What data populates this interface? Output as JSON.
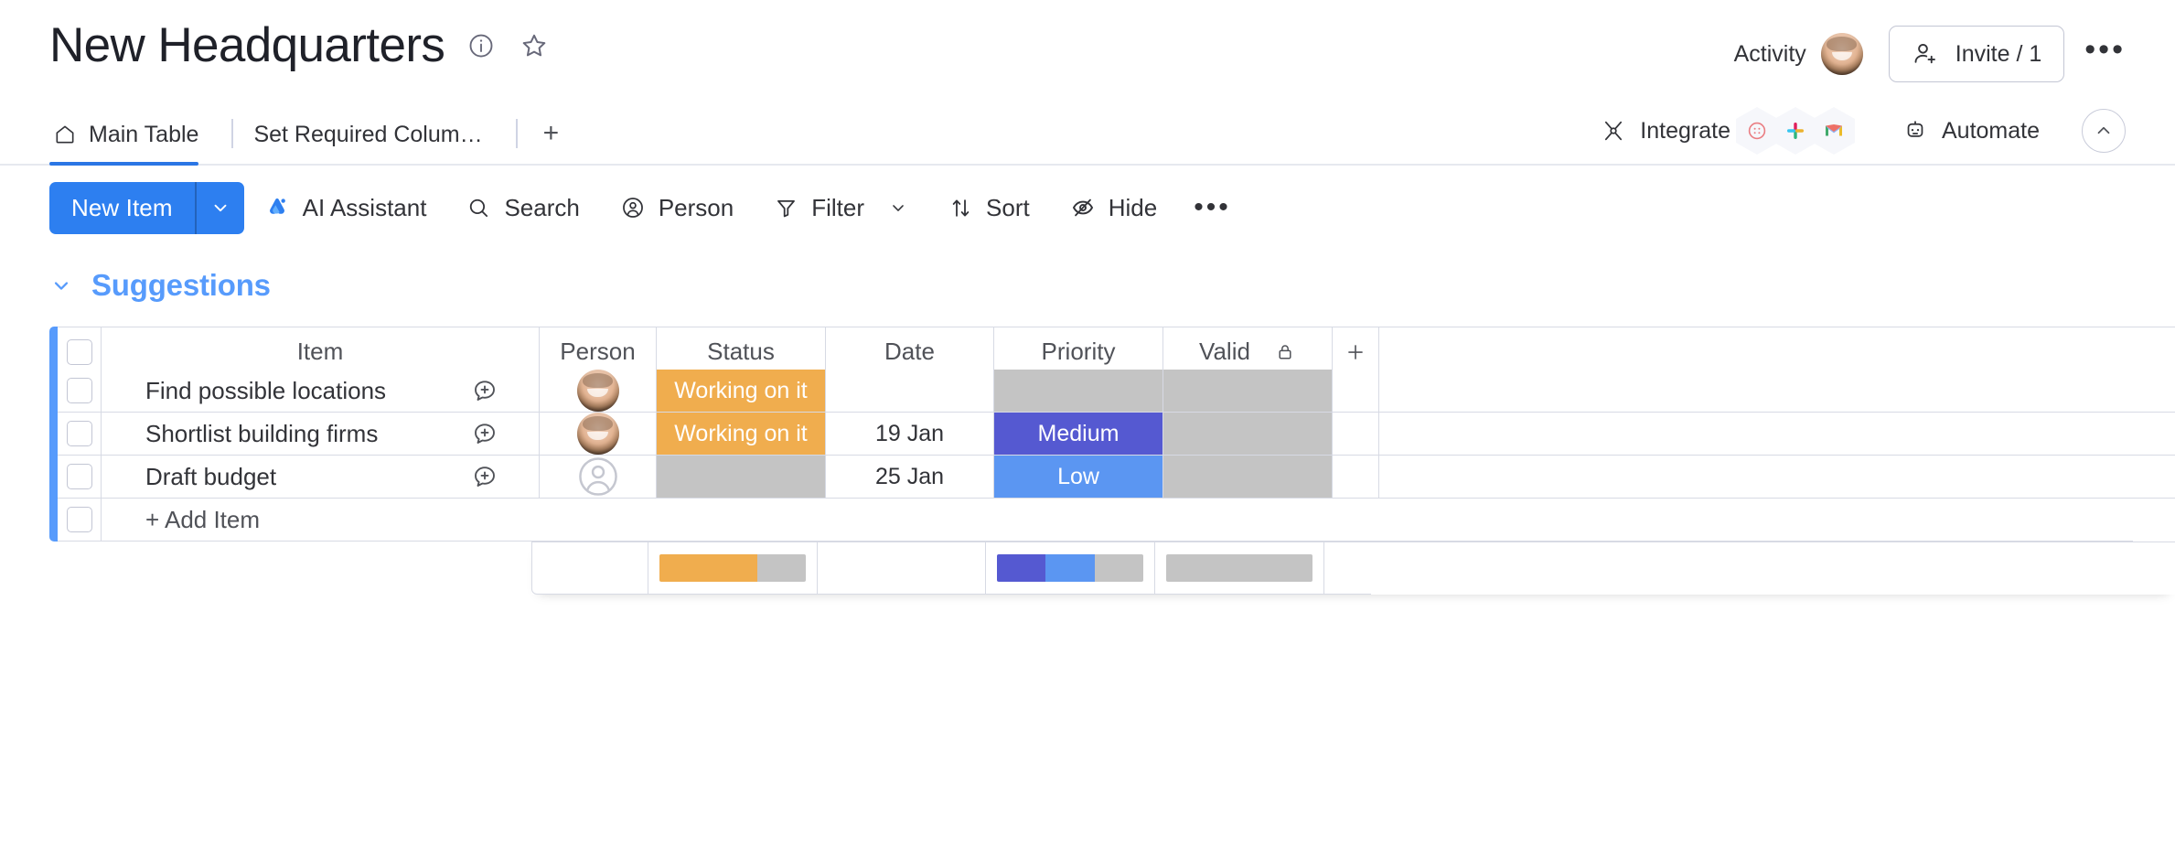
{
  "header": {
    "board_title": "New Headquarters",
    "info_icon": "info-circle-icon",
    "favorite_icon": "star-icon",
    "activity_label": "Activity",
    "invite_label": "Invite / 1",
    "more_label": "•••"
  },
  "tabs": {
    "items": [
      {
        "label": "Main Table",
        "icon": "home-icon",
        "active": true
      },
      {
        "label": "Set Required Colum…",
        "icon": "",
        "active": false
      }
    ],
    "add_tab_label": "+",
    "integrate_label": "Integrate",
    "integration_icons": [
      "dribbble-icon",
      "slack-icon",
      "gmail-icon"
    ],
    "automate_label": "Automate",
    "collapse_icon": "chevron-up-icon"
  },
  "toolbar": {
    "new_item_label": "New Item",
    "new_item_caret": "chevron-down-icon",
    "ai_assistant_label": "AI Assistant",
    "search_label": "Search",
    "person_label": "Person",
    "filter_label": "Filter",
    "sort_label": "Sort",
    "hide_label": "Hide",
    "more_label": "•••"
  },
  "group": {
    "name": "Suggestions",
    "color": "#579bfc",
    "collapse_icon": "chevron-down-icon"
  },
  "table": {
    "columns": [
      {
        "key": "item",
        "label": "Item"
      },
      {
        "key": "person",
        "label": "Person"
      },
      {
        "key": "status",
        "label": "Status"
      },
      {
        "key": "date",
        "label": "Date"
      },
      {
        "key": "priority",
        "label": "Priority"
      },
      {
        "key": "valid",
        "label": "Valid",
        "icon": "lock-icon"
      }
    ],
    "add_column_label": "+",
    "rows": [
      {
        "item": "Find possible locations",
        "person": "avatar-photo",
        "status": {
          "label": "Working on it",
          "color": "#f0ad4e"
        },
        "date": "",
        "priority": {
          "label": "",
          "color": "#c4c4c4"
        },
        "valid": {
          "label": "",
          "color": "#c4c4c4"
        }
      },
      {
        "item": "Shortlist building firms",
        "person": "avatar-photo",
        "status": {
          "label": "Working on it",
          "color": "#f0ad4e"
        },
        "date": "19 Jan",
        "priority": {
          "label": "Medium",
          "color": "#5559d1"
        },
        "valid": {
          "label": "",
          "color": "#c4c4c4"
        }
      },
      {
        "item": "Draft budget",
        "person": "avatar-empty",
        "status": {
          "label": "",
          "color": "#c4c4c4"
        },
        "date": "25 Jan",
        "priority": {
          "label": "Low",
          "color": "#5b96f2"
        },
        "valid": {
          "label": "",
          "color": "#c4c4c4"
        }
      }
    ],
    "add_item_label": "+ Add Item",
    "summary": {
      "status_segments": [
        {
          "color": "#f0ad4e",
          "pct": 67
        },
        {
          "color": "#c4c4c4",
          "pct": 33
        }
      ],
      "priority_segments": [
        {
          "color": "#5559d1",
          "pct": 33
        },
        {
          "color": "#5b96f2",
          "pct": 34
        },
        {
          "color": "#c4c4c4",
          "pct": 33
        }
      ],
      "valid_segments": [
        {
          "color": "#c4c4c4",
          "pct": 100
        }
      ]
    }
  }
}
